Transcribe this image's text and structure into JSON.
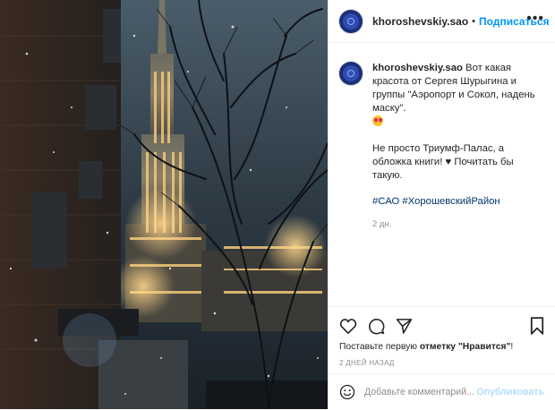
{
  "header": {
    "username": "khoroshevskiy.sao",
    "separator": "•",
    "follow_label": "Подписаться",
    "more_icon": "more-dots-icon"
  },
  "caption": {
    "username": "khoroshevskiy.sao",
    "text_part1": " Вот какая красота от Сергея Шурыгина и группы \"Аэропорт и Сокол, надень маску\".",
    "emoji": "star-struck-emoji",
    "text_part2_a": "Не просто Триумф-Палас, а обложка книги! ",
    "heart": "♥",
    "text_part2_b": " Почитать бы такую.",
    "tags": "#САО #ХорошевскийРайон",
    "time": "2 дн."
  },
  "actions": {
    "like_icon": "heart-icon",
    "comment_icon": "comment-icon",
    "share_icon": "share-icon",
    "save_icon": "bookmark-icon",
    "likes_prefix": "Поставьте первую ",
    "likes_link": "отметку \"Нравится\"",
    "likes_suffix": "!",
    "posted_ago": "2 ДНЕЙ НАЗАД"
  },
  "comment_box": {
    "emoji_icon": "smiley-icon",
    "placeholder": "Добавьте комментарий...",
    "post_label": "Опубликовать"
  },
  "colors": {
    "link_blue": "#0095f6",
    "tag_blue": "#00376b",
    "muted": "#8e8e8e",
    "post_disabled": "#b2dffc"
  }
}
